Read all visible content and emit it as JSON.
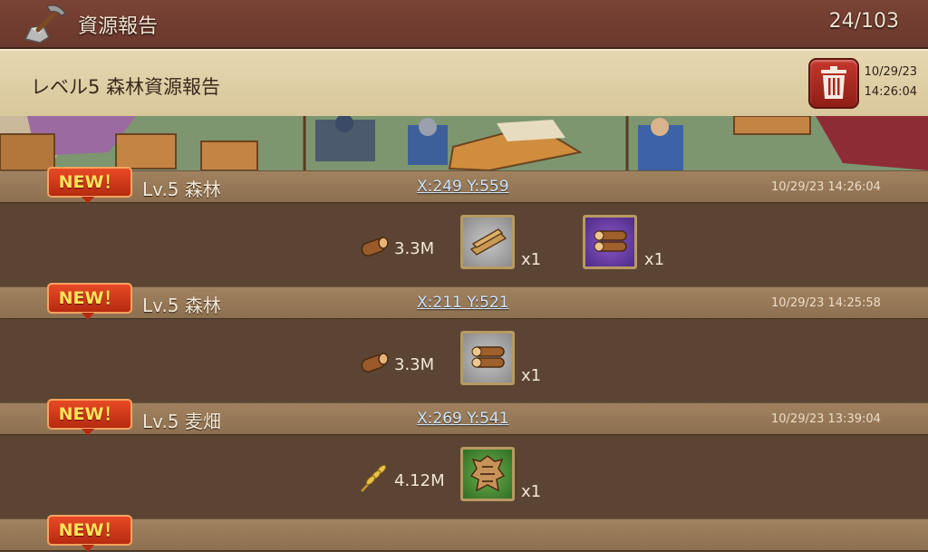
{
  "title_bar": {
    "title": "資源報告",
    "page_counter": "24/103",
    "icon": "pickaxe-ore-icon"
  },
  "report_header": {
    "title": "レベル5 森林資源報告",
    "date": "10/29/23",
    "time": "14:26:04",
    "delete_icon": "trash-icon"
  },
  "colors": {
    "title_bar": "#7a4336",
    "header_bar": "#e6d7b0",
    "entry_bar": "#a0825f",
    "body_bg": "#5b4433",
    "new_badge": "#e84a26",
    "coords_link": "#cfe5ff"
  },
  "entries": [
    {
      "badge": "NEW！",
      "name": "Lv.5 森林",
      "coords": "X:249 Y:559",
      "timestamp": "10/29/23 14:26:04",
      "resource_icon": "wood-log-icon",
      "amount": "3.3M",
      "items": [
        {
          "icon": "wooden-planks-icon",
          "frame": "grey",
          "qty": "x1"
        },
        {
          "icon": "log-bundle-icon",
          "frame": "purple",
          "qty": "x1"
        }
      ]
    },
    {
      "badge": "NEW！",
      "name": "Lv.5 森林",
      "coords": "X:211 Y:521",
      "timestamp": "10/29/23 14:25:58",
      "resource_icon": "wood-log-icon",
      "amount": "3.3M",
      "items": [
        {
          "icon": "log-bundle-icon",
          "frame": "grey",
          "qty": "x1"
        }
      ]
    },
    {
      "badge": "NEW！",
      "name": "Lv.5 麦畑",
      "coords": "X:269 Y:541",
      "timestamp": "10/29/23 13:39:04",
      "resource_icon": "wheat-icon",
      "amount": "4.12M",
      "items": [
        {
          "icon": "animal-hide-icon",
          "frame": "green",
          "qty": "x1"
        }
      ]
    },
    {
      "badge": "NEW！"
    }
  ]
}
